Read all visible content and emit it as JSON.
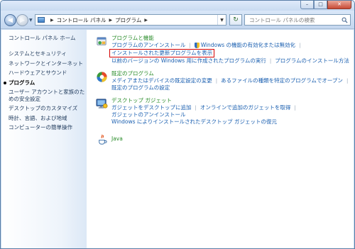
{
  "address": {
    "crumbs": [
      "コントロール パネル",
      "プログラム"
    ]
  },
  "search": {
    "placeholder": "コントロール パネルの検索"
  },
  "sidebar": {
    "home": "コントロール パネル ホーム",
    "items": [
      "システムとセキュリティ",
      "ネットワークとインターネット",
      "ハードウェアとサウンド",
      "プログラム",
      "ユーザー アカウントと家族のための安全設定",
      "デスクトップのカスタマイズ",
      "時計、言語、および地域",
      "コンピューターの簡単操作"
    ]
  },
  "categories": {
    "programs_features": {
      "title": "プログラムと機能",
      "links": [
        "プログラムのアンインストール",
        "Windows の機能の有効化または無効化",
        "インストールされた更新プログラムを表示",
        "以前のバージョンの Windows 用に作成されたプログラムの実行",
        "プログラムのインストール方法"
      ]
    },
    "default_programs": {
      "title": "既定のプログラム",
      "links": [
        "メディアまたはデバイスの既定設定の変更",
        "あるファイルの種類を特定のプログラムでオープン",
        "既定のプログラムの設定"
      ]
    },
    "gadgets": {
      "title": "デスクトップ ガジェット",
      "links": [
        "ガジェットをデスクトップに追加",
        "オンラインで追加のガジェットを取得",
        "ガジェットのアンインストール",
        "Windows によりインストールされたデスクトップ ガジェットの復元"
      ]
    },
    "java": {
      "title": "Java"
    }
  },
  "highlight_color": "#d40000"
}
